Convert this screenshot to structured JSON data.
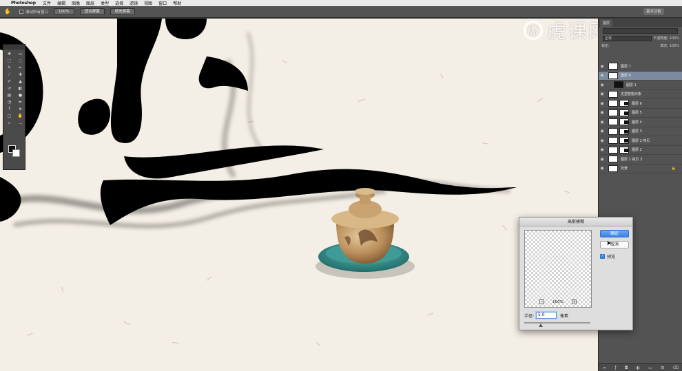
{
  "menubar": {
    "app_name": "Photoshop",
    "items": [
      "文件",
      "编辑",
      "图像",
      "图层",
      "类型",
      "选择",
      "滤镜",
      "视图",
      "窗口",
      "帮助"
    ]
  },
  "options": {
    "scroll_all_label": "滚动所有窗口",
    "zoom_value": "100%",
    "fit_screen_label": "适合屏幕",
    "fill_screen_label": "填充屏幕",
    "workspace_label": "基本功能"
  },
  "watermark": {
    "logo_char": "虎",
    "text": "虎课网"
  },
  "layers_panel": {
    "tab_label": "图层",
    "filter_label": "正常",
    "opacity_label": "不透明度: 100%",
    "lock_label": "锁定:",
    "fill_label": "填充: 100%",
    "layers": [
      {
        "name": "图层 7",
        "thumb": "light",
        "mask": false,
        "selected": false,
        "indent": false
      },
      {
        "name": "图层 8",
        "thumb": "light",
        "mask": false,
        "selected": true,
        "indent": false
      },
      {
        "name": "图层 1",
        "thumb": "dark",
        "mask": false,
        "selected": false,
        "indent": true
      },
      {
        "name": "龙墨智能对象",
        "thumb": "light",
        "mask": false,
        "selected": false,
        "indent": false
      },
      {
        "name": "图层 6",
        "thumb": "light",
        "mask": true,
        "selected": false,
        "indent": false
      },
      {
        "name": "图层 5",
        "thumb": "light",
        "mask": true,
        "selected": false,
        "indent": false
      },
      {
        "name": "图层 4",
        "thumb": "light",
        "mask": true,
        "selected": false,
        "indent": false
      },
      {
        "name": "图层 3",
        "thumb": "light",
        "mask": true,
        "selected": false,
        "indent": false
      },
      {
        "name": "图层 2 拷贝",
        "thumb": "light",
        "mask": true,
        "selected": false,
        "indent": false
      },
      {
        "name": "图层 2",
        "thumb": "light",
        "mask": true,
        "selected": false,
        "indent": false
      },
      {
        "name": "图层 1 拷贝 3",
        "thumb": "light",
        "mask": false,
        "selected": false,
        "indent": false
      },
      {
        "name": "背景",
        "thumb": "light",
        "mask": false,
        "selected": false,
        "indent": false,
        "locked": true
      }
    ]
  },
  "dialog": {
    "title": "高斯模糊",
    "ok_label": "确定",
    "cancel_label": "取消",
    "preview_label": "预览",
    "zoom_value": "100%",
    "radius_label": "半径:",
    "radius_value": "5.0",
    "radius_unit": "像素"
  }
}
